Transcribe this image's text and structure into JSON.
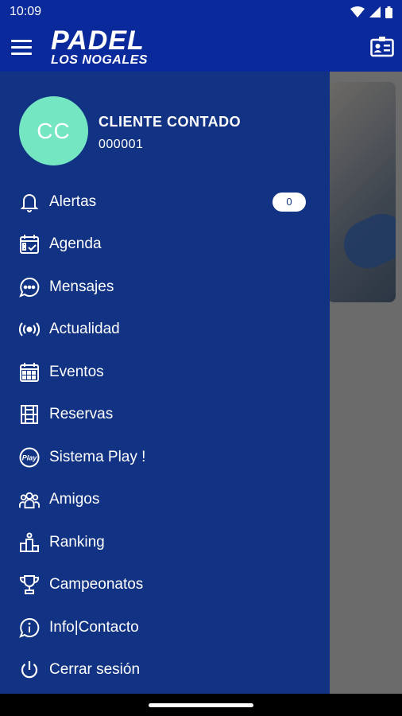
{
  "status_bar": {
    "time": "10:09"
  },
  "app_bar": {
    "logo_line1": "PADEL",
    "logo_line2": "LOS NOGALES"
  },
  "profile": {
    "initials": "CC",
    "name": "CLIENTE CONTADO",
    "id": "000001",
    "avatar_color": "#75e6c2"
  },
  "menu": [
    {
      "label": "Alertas",
      "icon": "bell-icon",
      "badge": "0"
    },
    {
      "label": "Agenda",
      "icon": "calendar-check-icon"
    },
    {
      "label": "Mensajes",
      "icon": "chat-bubble-icon"
    },
    {
      "label": "Actualidad",
      "icon": "broadcast-icon"
    },
    {
      "label": "Eventos",
      "icon": "calendar-grid-icon"
    },
    {
      "label": "Reservas",
      "icon": "court-icon"
    },
    {
      "label": "Sistema Play !",
      "icon": "play-icon"
    },
    {
      "label": "Amigos",
      "icon": "friends-icon"
    },
    {
      "label": "Ranking",
      "icon": "podium-icon"
    },
    {
      "label": "Campeonatos",
      "icon": "trophy-icon"
    },
    {
      "label": "Info|Contacto",
      "icon": "info-bubble-icon"
    },
    {
      "label": "Cerrar sesión",
      "icon": "power-icon"
    }
  ],
  "colors": {
    "primary": "#0a2a9c",
    "drawer": "#123383",
    "accent": "#75e6c2"
  }
}
